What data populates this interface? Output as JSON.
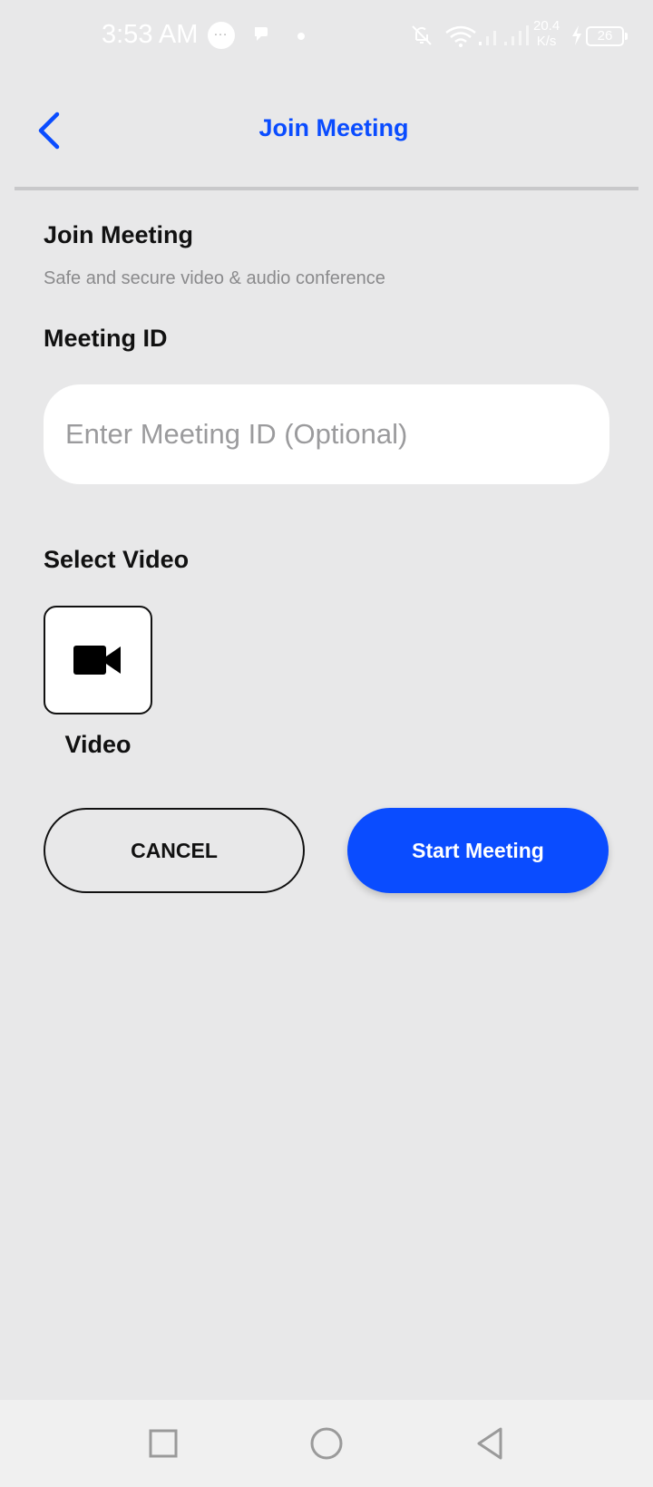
{
  "status_bar": {
    "time": "3:53 AM",
    "net_speed_value": "20.4",
    "net_speed_unit": "K/s",
    "battery": "26"
  },
  "app_bar": {
    "title": "Join Meeting",
    "back_icon": "chevron-left-icon"
  },
  "form": {
    "heading": "Join Meeting",
    "subtitle": "Safe and secure video & audio conference",
    "meeting_id_label": "Meeting ID",
    "meeting_id_value": "",
    "meeting_id_placeholder": "Enter Meeting ID (Optional)",
    "select_video_label": "Select Video",
    "video_option_label": "Video",
    "video_option_icon": "video-camera-icon"
  },
  "actions": {
    "cancel_label": "CANCEL",
    "start_label": "Start Meeting"
  },
  "nav_bar": {
    "recents_icon": "square-icon",
    "home_icon": "circle-icon",
    "back_icon": "triangle-back-icon"
  },
  "colors": {
    "accent": "#0a4cff",
    "background": "#e8e8e9",
    "text": "#111111",
    "muted": "#8a8a8c"
  }
}
